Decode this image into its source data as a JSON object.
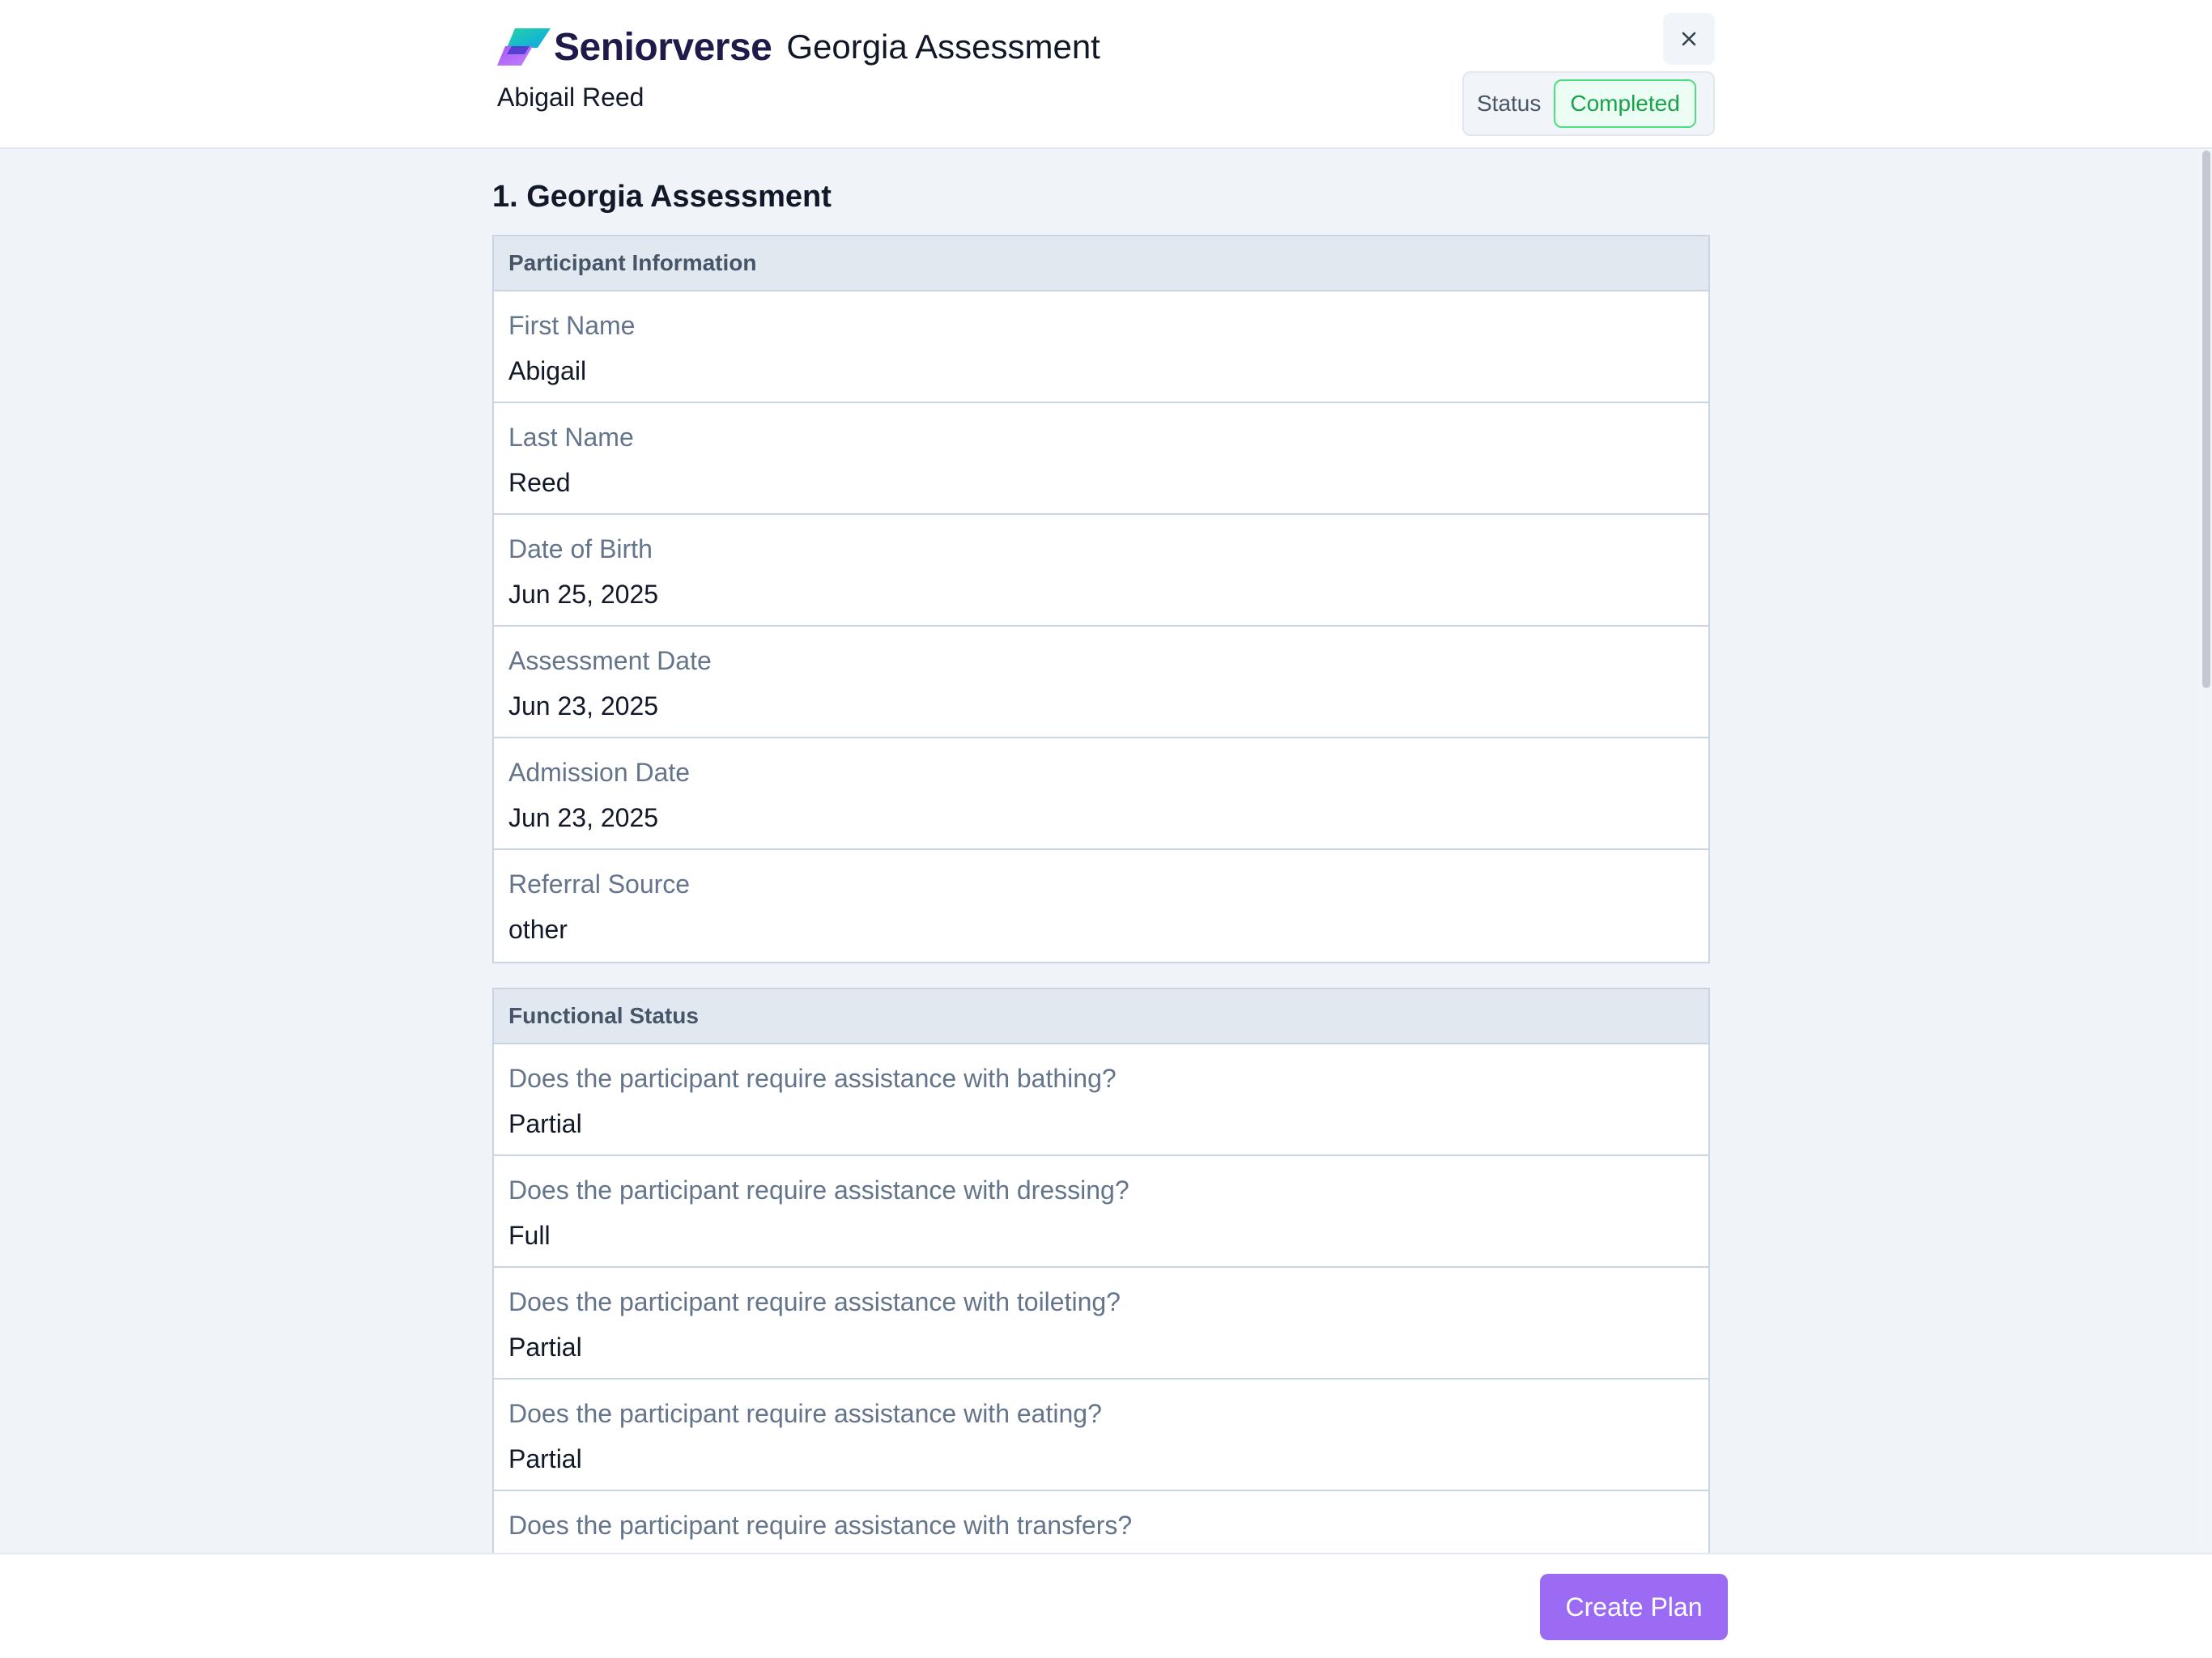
{
  "header": {
    "brand_name": "Seniorverse",
    "title": "Georgia Assessment",
    "participant_name": "Abigail Reed",
    "status_label": "Status",
    "status_value": "Completed"
  },
  "section": {
    "heading": "1. Georgia Assessment"
  },
  "participant_info": {
    "title": "Participant Information",
    "fields": [
      {
        "label": "First Name",
        "value": "Abigail"
      },
      {
        "label": "Last Name",
        "value": "Reed"
      },
      {
        "label": "Date of Birth",
        "value": "Jun 25, 2025"
      },
      {
        "label": "Assessment Date",
        "value": "Jun 23, 2025"
      },
      {
        "label": "Admission Date",
        "value": "Jun 23, 2025"
      },
      {
        "label": "Referral Source",
        "value": "other"
      }
    ]
  },
  "functional_status": {
    "title": "Functional Status",
    "fields": [
      {
        "label": "Does the participant require assistance with bathing?",
        "value": "Partial"
      },
      {
        "label": "Does the participant require assistance with dressing?",
        "value": "Full"
      },
      {
        "label": "Does the participant require assistance with toileting?",
        "value": "Partial"
      },
      {
        "label": "Does the participant require assistance with eating?",
        "value": "Partial"
      },
      {
        "label": "Does the participant require assistance with transfers?",
        "value": ""
      }
    ]
  },
  "footer": {
    "create_plan_label": "Create Plan"
  },
  "colors": {
    "brand": "#1e1b4b",
    "accent": "#9b6cf3",
    "status_green": "#16a34a"
  },
  "icons": {
    "close": "close-icon",
    "logo": "seniorverse-logo-icon"
  }
}
